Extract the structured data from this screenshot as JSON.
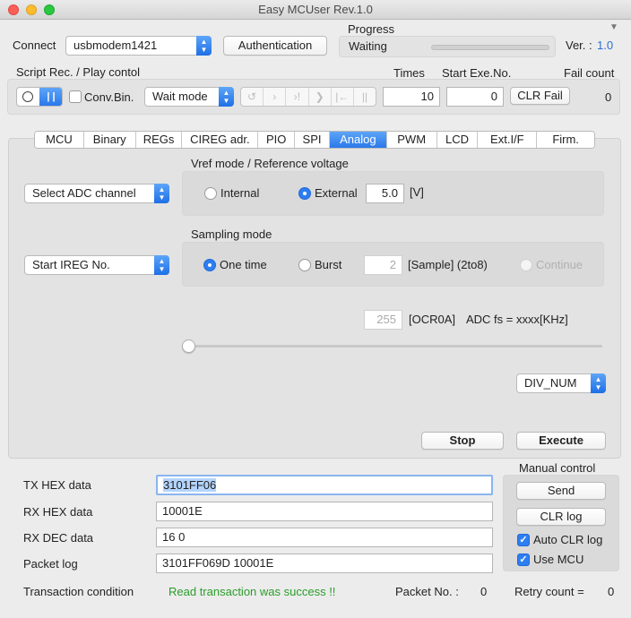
{
  "window": {
    "title": "Easy MCUser Rev.1.0"
  },
  "colors": {
    "accent": "#2d7ef0",
    "success": "#2a9d2a",
    "version": "#2d6fd6"
  },
  "connect": {
    "label": "Connect",
    "port": "usbmodem1421",
    "auth_button": "Authentication"
  },
  "progress": {
    "label": "Progress",
    "status": "Waiting",
    "fraction": 0
  },
  "version": {
    "label": "Ver. :",
    "value": "1.0"
  },
  "script": {
    "title": "Script Rec. / Play contol",
    "conv_bin_label": "Conv.Bin.",
    "conv_bin_checked": false,
    "mode": "Wait mode",
    "transport_icons": [
      "refresh-icon",
      "next-icon",
      "next-stop-icon",
      "step-icon",
      "to-start-icon",
      "pause-icon"
    ],
    "times_label": "Times",
    "times_value": "10",
    "start_exe_label": "Start Exe.No.",
    "start_exe_value": "0",
    "clr_fail_button": "CLR Fail",
    "fail_count_label": "Fail count",
    "fail_count_value": "0"
  },
  "tabs": [
    "MCU",
    "Binary",
    "REGs",
    "CIREG adr.",
    "PIO",
    "SPI",
    "Analog",
    "PWM",
    "LCD",
    "Ext.I/F",
    "Firm."
  ],
  "active_tab": "Analog",
  "analog": {
    "adc_channel_select": "Select ADC channel",
    "vref_title": "Vref mode / Reference voltage",
    "vref_internal": "Internal",
    "vref_external": "External",
    "vref_selected": "External",
    "vref_value": "5.0",
    "vref_unit": "[V]",
    "ireg_select": "Start IREG No.",
    "sampling_title": "Sampling mode",
    "sampling_one_time": "One time",
    "sampling_burst": "Burst",
    "sampling_selected": "One time",
    "sample_value": "2",
    "sample_unit": "[Sample] (2to8)",
    "continue_label": "Continue",
    "ocr_value": "255",
    "ocr_label": "[OCR0A]",
    "adc_fs_label": "ADC fs = xxxx[KHz]",
    "slider_level": 0,
    "div_select": "DIV_NUM",
    "stop_button": "Stop",
    "execute_button": "Execute"
  },
  "data": {
    "tx_label": "TX HEX data",
    "tx_value": "3101FF06",
    "rx_label": "RX HEX data",
    "rx_value": "10001E",
    "rx_dec_label": "RX DEC data",
    "rx_dec_value": "16 0",
    "log_label": "Packet log",
    "log_value": "3101FF069D 10001E"
  },
  "manual": {
    "title": "Manual control",
    "send_button": "Send",
    "clr_log_button": "CLR log",
    "auto_clr_label": "Auto CLR log",
    "auto_clr_checked": true,
    "use_mcu_label": "Use MCU",
    "use_mcu_checked": true
  },
  "status": {
    "transaction_label": "Transaction condition",
    "transaction_value": "Read transaction was success !!",
    "packet_label": "Packet No. :",
    "packet_value": "0",
    "retry_label": "Retry count =",
    "retry_value": "0"
  }
}
